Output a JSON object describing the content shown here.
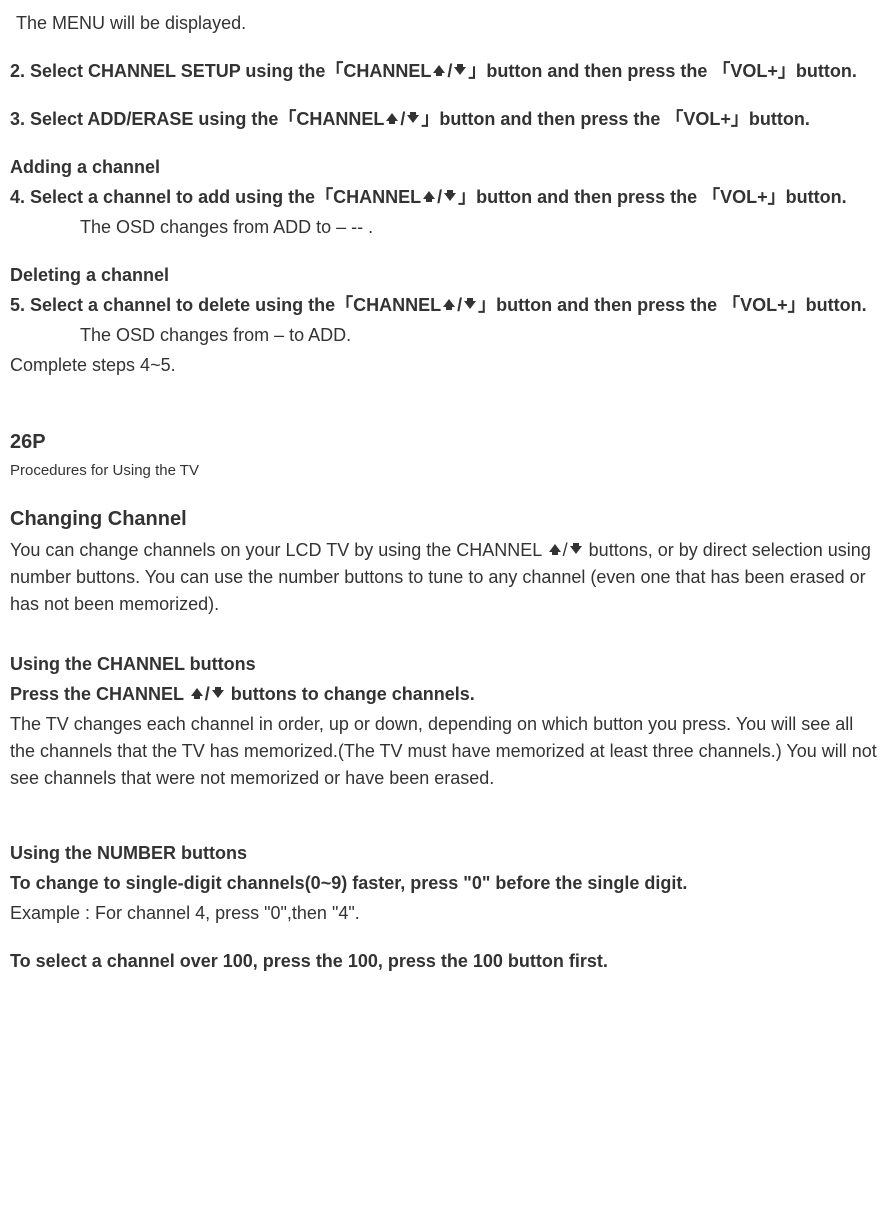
{
  "line_menu": "The MENU will be displayed.",
  "step2_a": "2. Select CHANNEL SETUP using the「CHANNEL",
  "step2_b": "」button and then press the 「VOL+」button.",
  "step3_a": "3. Select ADD/ERASE using the「CHANNEL",
  "step3_b": "」button and then press the 「VOL+」button.",
  "adding_heading": "Adding a channel",
  "step4_a": "4. Select a channel to add using the「CHANNEL",
  "step4_b": "」button and then press the 「VOL+」button.",
  "step4_sub": "The OSD changes from ADD to – -- .",
  "deleting_heading": "Deleting a channel",
  "step5_a": "5. Select a channel to delete using the「CHANNEL",
  "step5_b": "」button and then press the 「VOL+」button.",
  "step5_sub": "The OSD changes from – to ADD.",
  "complete": "Complete steps 4~5.",
  "page_num": "26P",
  "procedures": "Procedures for Using the TV",
  "changing_heading": "Changing Channel",
  "changing_p1_a": "You can change channels on your LCD TV by using the CHANNEL ",
  "changing_p1_b": " buttons, or by direct selection using number buttons. You can use the number buttons to tune to any channel (even one that has been erased or has not been memorized).",
  "using_channel_heading": "Using the CHANNEL buttons",
  "using_channel_bold_a": "Press the CHANNEL ",
  "using_channel_bold_b": " buttons to change channels.",
  "using_channel_p": "The TV changes each channel in order, up or down, depending on which button you press. You will see all the channels that the TV has memorized.(The TV must have memorized at least three channels.) You will not see channels that were not memorized or have been erased.",
  "using_number_heading": "Using the NUMBER buttons",
  "using_number_bold1": "To change to single-digit channels(0~9) faster, press \"0\" before the single digit.",
  "using_number_example": "Example : For channel 4, press \"0\",then \"4\".",
  "using_number_bold2": "To select a channel over 100, press the 100, press the 100 button first.",
  "slash": "/"
}
